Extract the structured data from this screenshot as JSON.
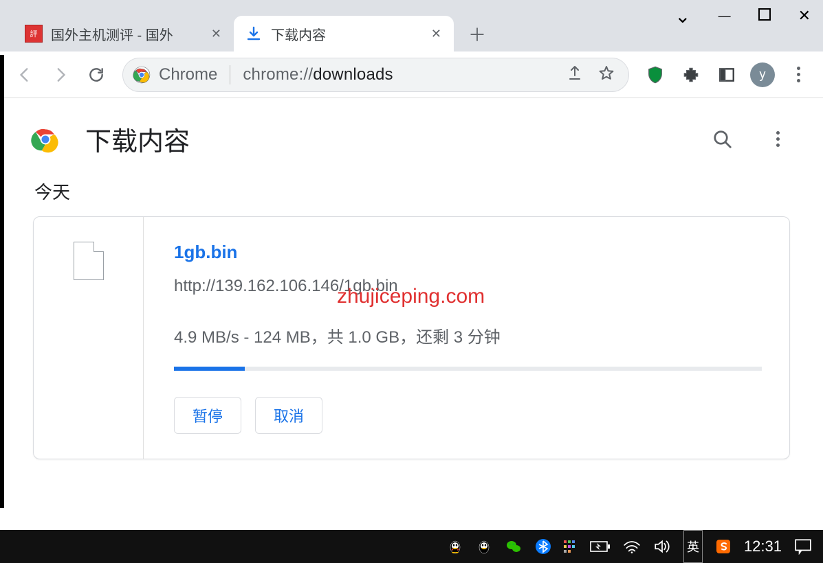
{
  "window_controls": {
    "tabs_dropdown": "⌄",
    "minimize": "—",
    "maximize": "□",
    "close": "✕"
  },
  "tabs": [
    {
      "title": "国外主机测评 - 国外",
      "active": false
    },
    {
      "title": "下载内容",
      "active": true
    }
  ],
  "toolbar": {
    "omnibox_label": "Chrome",
    "omnibox_prefix": "chrome://",
    "omnibox_bold": "downloads",
    "avatar_letter": "y"
  },
  "downloads_page": {
    "header_title": "下载内容",
    "section_today": "今天",
    "item": {
      "filename": "1gb.bin",
      "url": "http://139.162.106.146/1gb.bin",
      "progress_text": "4.9 MB/s - 124 MB，共 1.0 GB，还剩 3 分钟",
      "progress_pct": 12,
      "pause_label": "暂停",
      "cancel_label": "取消"
    }
  },
  "watermark": "zhujiceping.com",
  "taskbar": {
    "ime_label": "英",
    "clock": "12:31"
  }
}
